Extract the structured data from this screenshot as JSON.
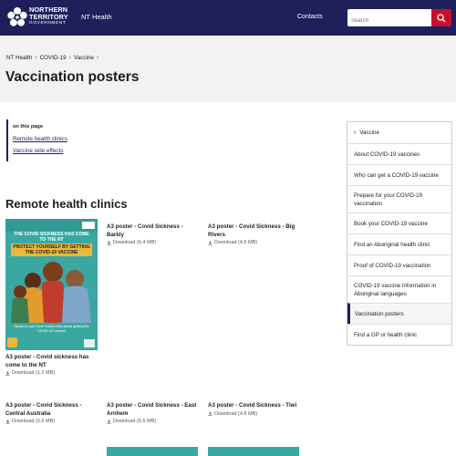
{
  "header": {
    "logo_lines": [
      "NORTHERN",
      "TERRITORY",
      "GOVERNMENT"
    ],
    "site_name": "NT Health",
    "contacts_label": "Contacts",
    "search_placeholder": "Search",
    "bg_color": "#1f1f5c",
    "search_button_color": "#c8102e"
  },
  "breadcrumb": [
    "NT Health",
    "COVID-19",
    "Vaccine"
  ],
  "page_title": "Vaccination posters",
  "on_this_page": {
    "title": "on this page",
    "links": [
      "Remote health clinics",
      "Vaccine side effects"
    ]
  },
  "section_title": "Remote health clinics",
  "poster_preview": {
    "banner_1": "THE COVID SICKNESS HAS COME TO THE NT",
    "banner_2": "PROTECT YOURSELF BY GETTING THE COVID-19 VACCINE",
    "footer": "Speak to your local health clinic about getting the COVID-19 vaccine",
    "color": "#3aa8a0"
  },
  "posters": [
    {
      "title": "A3 poster - Covid Sickness - Barkly",
      "download": "Download (6.4 MB)"
    },
    {
      "title": "A3 poster - Covid Sickness - Big Rivers",
      "download": "Download (4.5 MB)"
    },
    {
      "title": "A3 poster - Covid sickness has come to the NT",
      "download": "Download (1.2 MB)"
    },
    {
      "title": "A3 poster - Covid Sickness - Central Australia",
      "download": "Download (6.5 MB)"
    },
    {
      "title": "A3 poster - Covid Sickness - East Arnhem",
      "download": "Download (6.5 MB)"
    },
    {
      "title": "A3 poster - Covid Sickness - Tiwi",
      "download": "Download (4.8 MB)"
    }
  ],
  "sidebar": {
    "back_label": "Vaccine",
    "items": [
      "About COVID-19 vaccines",
      "Who can get a COVID-19 vaccine",
      "Prepare for your COVID-19 vaccination",
      "Book your COVID-19 vaccine",
      "Find an Aboriginal health clinic",
      "Proof of COVID-19 vaccination",
      "COVID-19 vaccine information in Aboriginal languages",
      "Vaccination posters",
      "Find a GP or health clinic"
    ],
    "active_item": "Vaccination posters",
    "accent_color": "#1f1f5c"
  }
}
